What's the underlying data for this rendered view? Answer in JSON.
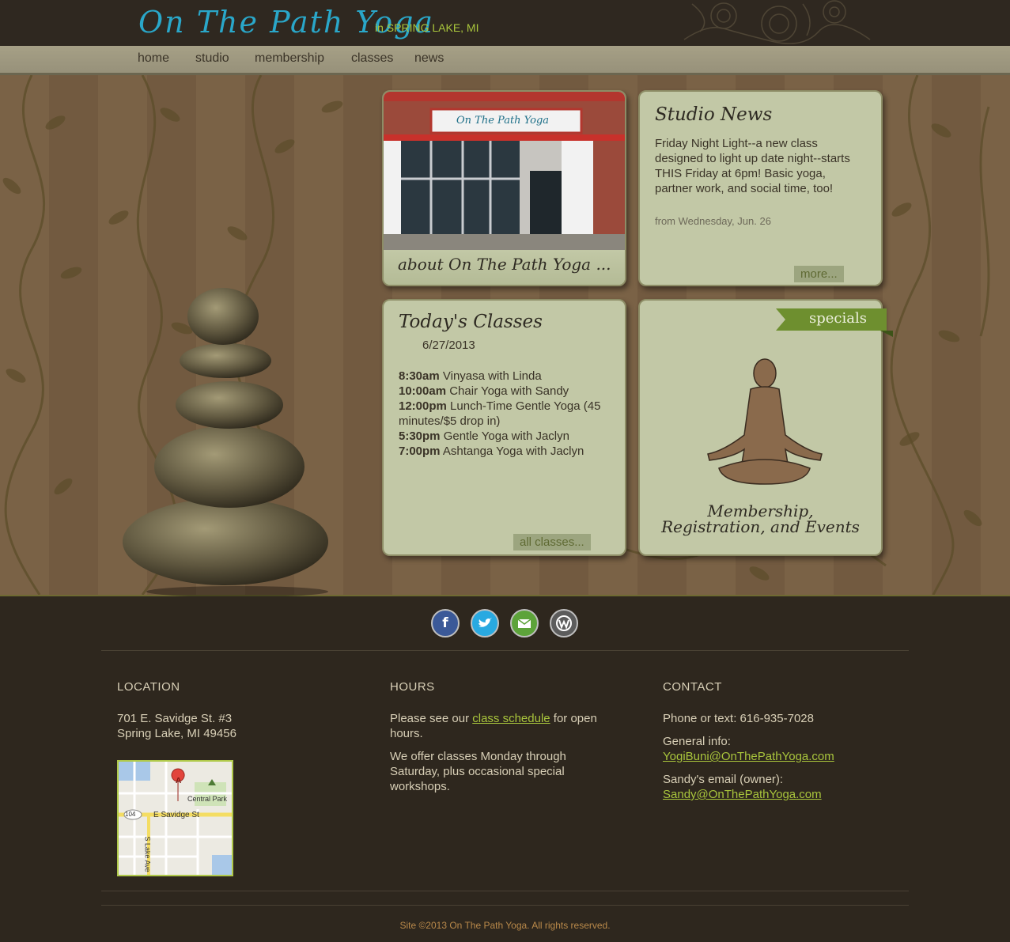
{
  "header": {
    "logo": "On The Path Yoga",
    "tagline": "in SPRING LAKE, MI"
  },
  "nav": {
    "items": [
      "home",
      "studio",
      "membership",
      "classes",
      "news"
    ]
  },
  "about_card": {
    "sign_text": "On The Path Yoga",
    "caption": "about On The Path Yoga ..."
  },
  "news_card": {
    "title": "Studio News",
    "text": "Friday Night Light--a new class designed to light up date night--starts THIS Friday at 6pm! Basic yoga, partner work, and social time, too!",
    "date": "from Wednesday, Jun. 26",
    "more": "more..."
  },
  "classes_card": {
    "title": "Today's Classes",
    "date": "6/27/2013",
    "items": [
      {
        "time": "8:30am",
        "name": "Vinyasa with Linda"
      },
      {
        "time": "10:00am",
        "name": "Chair Yoga with Sandy"
      },
      {
        "time": "12:00pm",
        "name": "Lunch-Time Gentle Yoga (45 minutes/$5 drop in)"
      },
      {
        "time": "5:30pm",
        "name": "Gentle Yoga with Jaclyn"
      },
      {
        "time": "7:00pm",
        "name": "Ashtanga Yoga with Jaclyn"
      }
    ],
    "all": "all classes..."
  },
  "specials_card": {
    "ribbon": "specials",
    "caption": "Membership, Registration, and Events"
  },
  "social": {
    "icons": [
      "facebook-icon",
      "twitter-icon",
      "email-icon",
      "wordpress-icon"
    ]
  },
  "location": {
    "heading": "LOCATION",
    "address_line1": "701 E. Savidge St. #3",
    "address_line2": "Spring Lake, MI 49456",
    "map": {
      "marker": "A",
      "park": "Central Park",
      "street": "E Savidge St",
      "route": "104",
      "avenue": "S Lake Ave"
    }
  },
  "hours": {
    "heading": "HOURS",
    "p1_pre": "Please see our ",
    "p1_link": "class schedule",
    "p1_post": " for open hours.",
    "p2": "We offer classes Monday through Saturday, plus occasional special workshops."
  },
  "contact": {
    "heading": "CONTACT",
    "phone": "Phone or text: 616-935-7028",
    "general_label": "General info:",
    "general_email": "YogiBuni@OnThePathYoga.com",
    "owner_label": "Sandy's email (owner):",
    "owner_email": "Sandy@OnThePathYoga.com"
  },
  "copyright": "Site ©2013 On The Path Yoga. All rights reserved.",
  "colors": {
    "brand_teal": "#2aa7c9",
    "accent_green": "#a9c53c",
    "card_bg": "#c2c8a6",
    "footer_bg": "#2e271e"
  }
}
